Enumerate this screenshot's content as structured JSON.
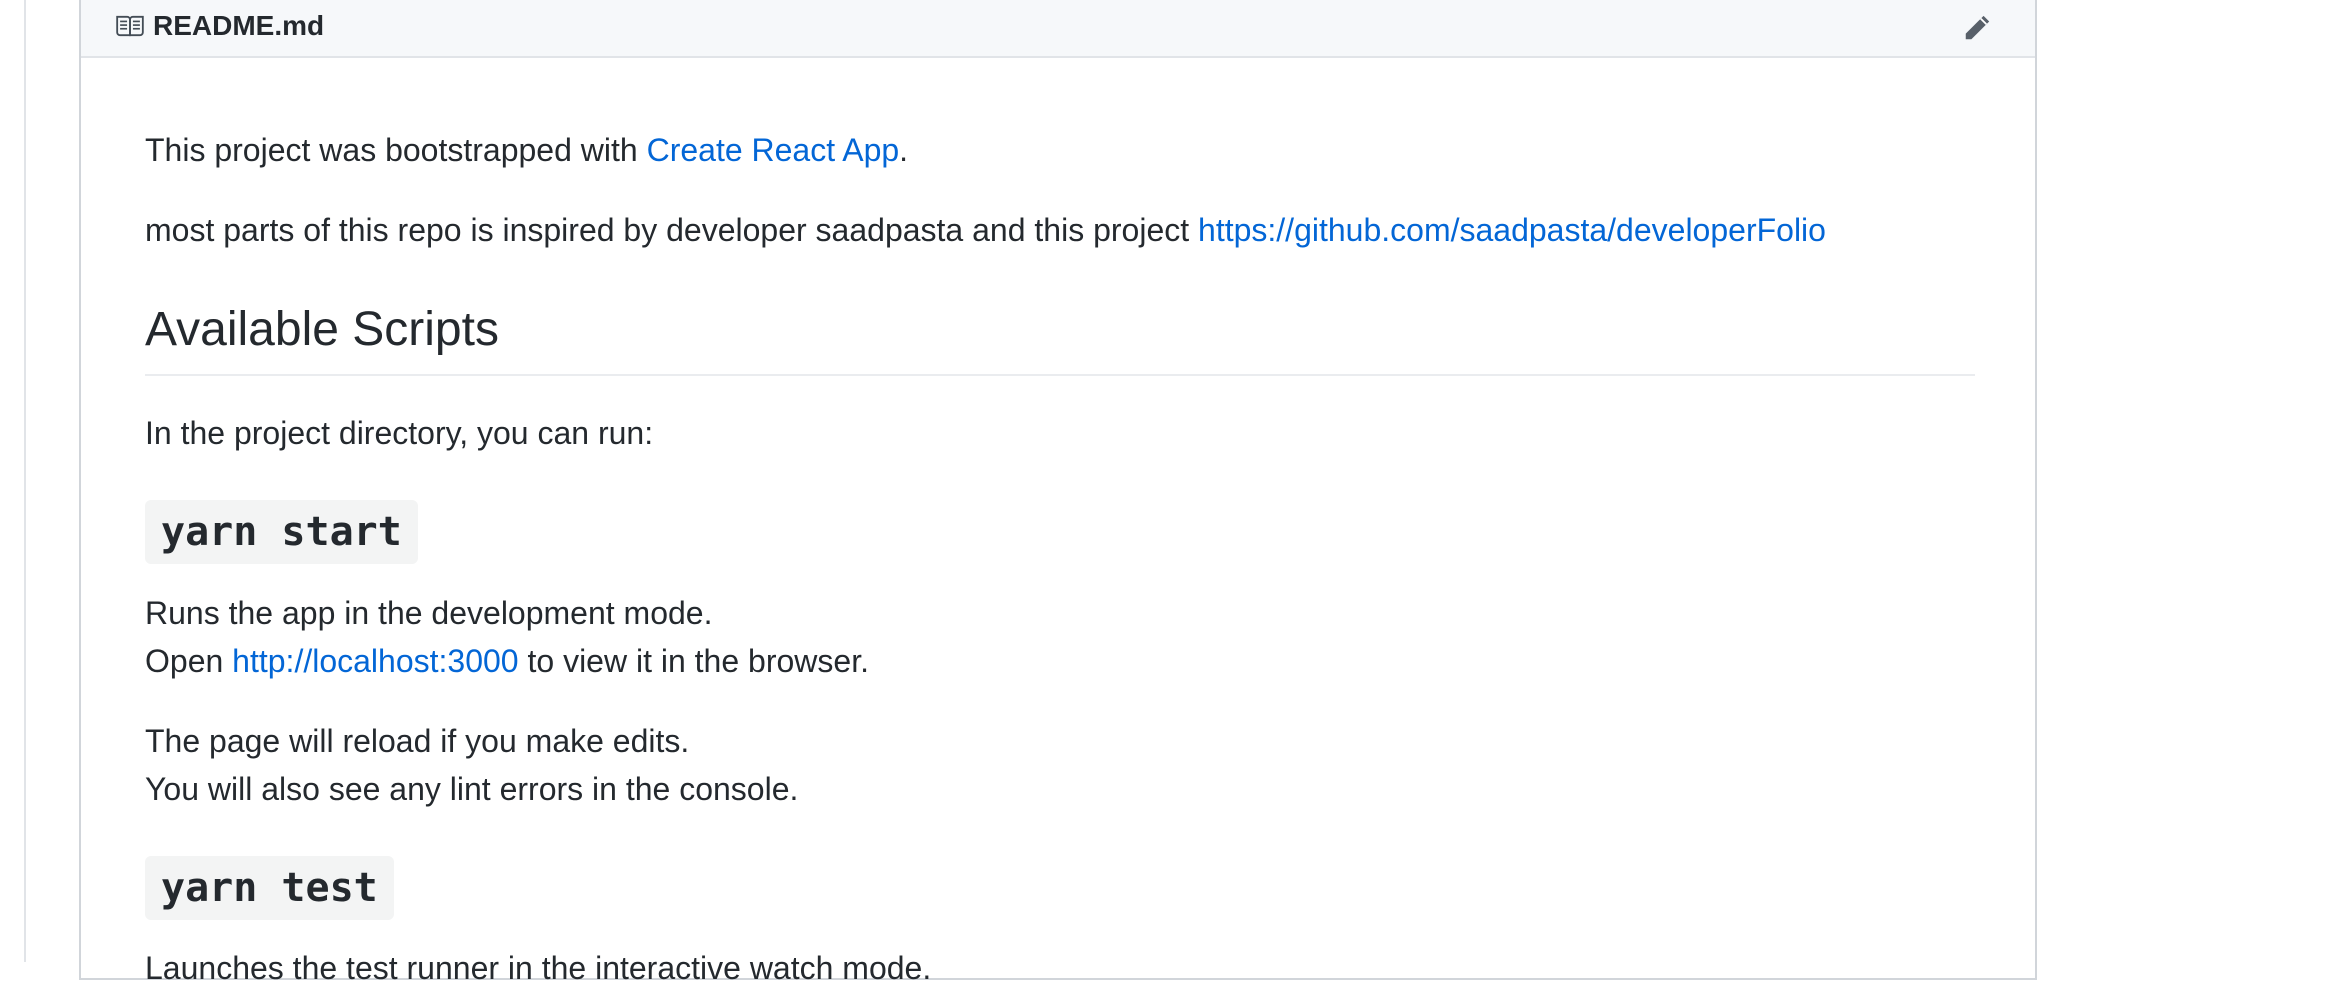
{
  "readme": {
    "filename": "README.md",
    "edit_label": "Edit this file"
  },
  "content": {
    "intro_prefix": "This project was bootstrapped with ",
    "intro_link": "Create React App",
    "intro_suffix": ".",
    "inspired_text": "most parts of this repo is inspired by developer saadpasta and this project ",
    "inspired_link": "https://github.com/saadpasta/developerFolio",
    "scripts_heading": "Available Scripts",
    "scripts_intro": "In the project directory, you can run:",
    "start_command": "yarn start",
    "start_line1": "Runs the app in the development mode.",
    "start_line2_prefix": "Open ",
    "start_line2_link": "http://localhost:3000",
    "start_line2_suffix": " to view it in the browser.",
    "reload_line1": "The page will reload if you make edits.",
    "reload_line2": "You will also see any lint errors in the console.",
    "test_command": "yarn test",
    "test_line1": "Launches the test runner in the interactive watch mode."
  },
  "colors": {
    "link": "#0366d6",
    "text": "#24292e",
    "header_bg": "#f6f8fa",
    "code_bg": "#f3f4f4"
  },
  "icons": {
    "header": "book-icon",
    "edit": "pencil-icon"
  }
}
